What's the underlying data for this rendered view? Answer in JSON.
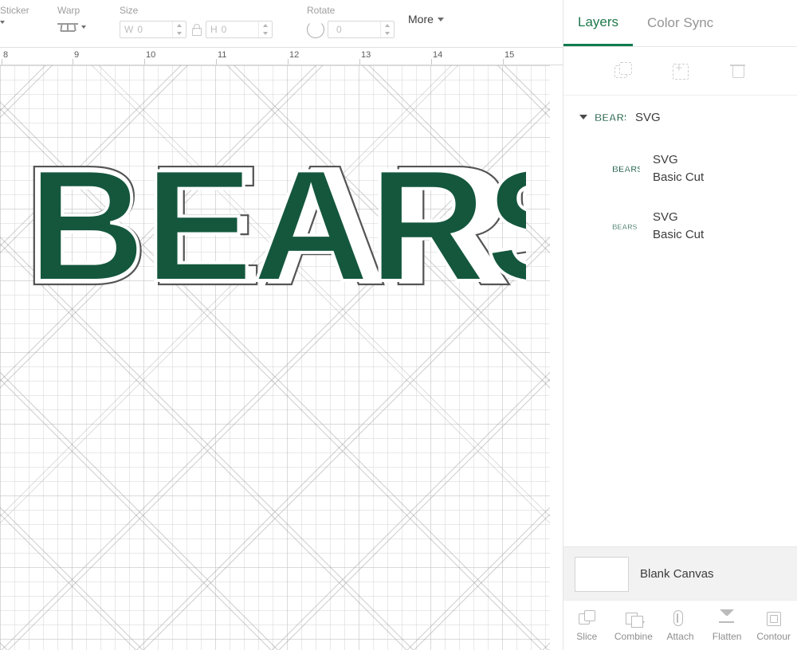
{
  "toolbar": {
    "groups": [
      {
        "label": "Sticker",
        "icon": "sticker-icon"
      },
      {
        "label": "Warp",
        "icon": "warp-icon"
      },
      {
        "label": "Size",
        "icon": "size-lock-icon"
      },
      {
        "label": "Rotate",
        "icon": "rotate-icon"
      }
    ],
    "size": {
      "width_key": "W",
      "width_value": "0",
      "height_key": "H",
      "height_value": "0",
      "lock_icon": "lock-icon"
    },
    "rotate": {
      "value": "0"
    },
    "more_label": "More"
  },
  "ruler": {
    "ticks": [
      "8",
      "9",
      "10",
      "11",
      "12",
      "13",
      "14",
      "15"
    ]
  },
  "canvas": {
    "artwork_text": "BEARS",
    "fill_color": "#14573d",
    "outline_color": "#ffffff",
    "stroke_color": "#555555"
  },
  "panel": {
    "tabs": [
      {
        "label": "Layers",
        "active": true
      },
      {
        "label": "Color Sync",
        "active": false
      }
    ],
    "actions": [
      {
        "name": "duplicate-layer",
        "icon": "duplicate-icon"
      },
      {
        "name": "add-layer",
        "icon": "add-icon"
      },
      {
        "name": "delete-layer",
        "icon": "trash-icon"
      }
    ],
    "layers": [
      {
        "title": "SVG",
        "expanded": true,
        "thumb_text": "BEARS",
        "children": [
          {
            "title": "SVG",
            "subtitle": "Basic Cut",
            "thumb_text": "BEARS"
          },
          {
            "title": "SVG",
            "subtitle": "Basic Cut",
            "thumb_text": "BEARS"
          }
        ]
      }
    ],
    "canvas_row": {
      "label": "Blank Canvas"
    },
    "footer": [
      {
        "label": "Slice",
        "icon": "slice-icon",
        "has_caret": false
      },
      {
        "label": "Combine",
        "icon": "combine-icon",
        "has_caret": true
      },
      {
        "label": "Attach",
        "icon": "attach-icon",
        "has_caret": false
      },
      {
        "label": "Flatten",
        "icon": "flatten-icon",
        "has_caret": false
      },
      {
        "label": "Contour",
        "icon": "contour-icon",
        "has_caret": false
      }
    ]
  },
  "colors": {
    "accent": "#0f7a4f",
    "artwork_green": "#14573d",
    "panel_bg": "#ffffff"
  }
}
